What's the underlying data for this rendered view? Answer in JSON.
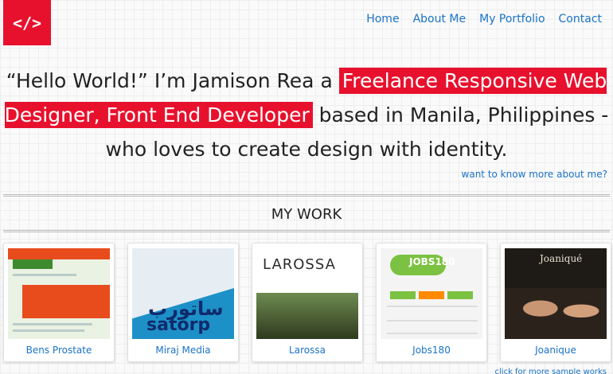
{
  "logo": {
    "text": "</>"
  },
  "nav": [
    "Home",
    "About Me",
    "My Portfolio",
    "Contact"
  ],
  "hero": {
    "intro": "“Hello World!” I’m Jamison Rea a ",
    "highlight": "Freelance Responsive Web Designer, Front End Developer",
    "outro": " based in Manila, Philippines - who loves to create design with identity."
  },
  "more_link": "want to know more about me?",
  "section_title": "MY WORK",
  "works": [
    {
      "title": "Bens Prostate"
    },
    {
      "title": "Miraj Media",
      "thumb_text": [
        "ساتورب",
        "satorp"
      ]
    },
    {
      "title": "Larossa",
      "thumb_text": "LAROSSA"
    },
    {
      "title": "Jobs180",
      "thumb_text": "JOBS180"
    },
    {
      "title": "Joanique",
      "thumb_text": "Joaniqué"
    }
  ],
  "click_more": "click for more sample works",
  "colors": {
    "accent": "#e8112d",
    "link": "#1a73c6"
  }
}
